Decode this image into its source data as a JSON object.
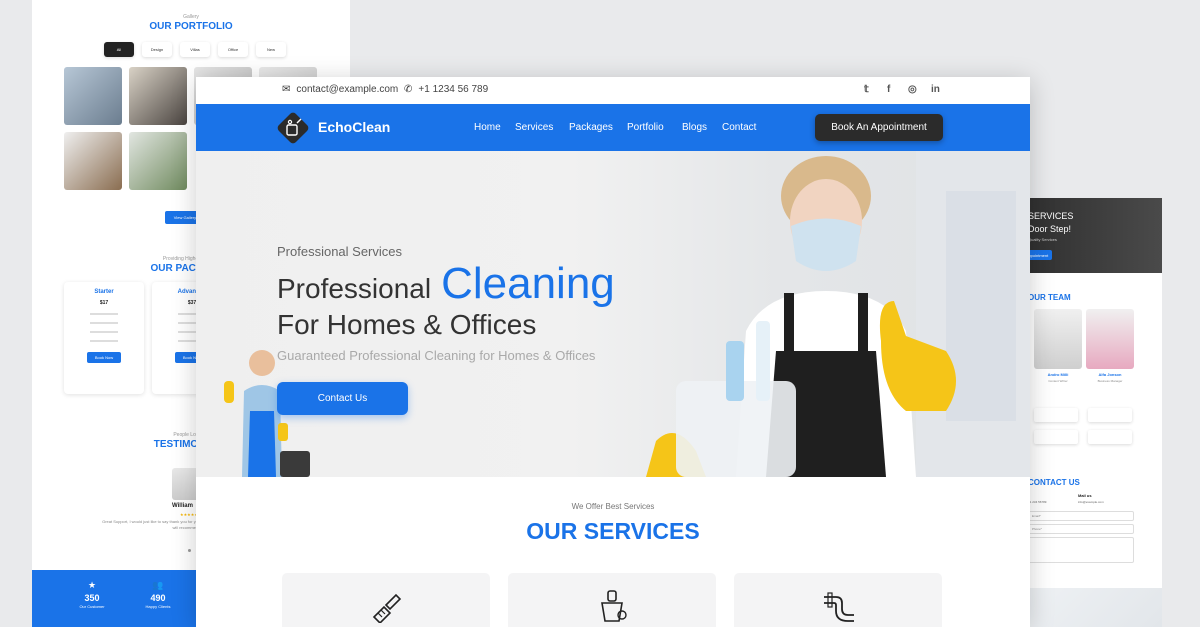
{
  "left_page": {
    "portfolio": {
      "kicker": "Gallery",
      "title": "OUR PORTFOLIO",
      "tabs": [
        "All",
        "Design",
        "Villas",
        "Office",
        "New"
      ],
      "button": "View Gallery"
    },
    "packages": {
      "kicker": "Providing Highest Quality",
      "title": "OUR PACKAGES",
      "cards": [
        {
          "name": "Starter",
          "price": "$17",
          "button": "Book Now"
        },
        {
          "name": "Advanced",
          "price": "$37",
          "button": "Book Now"
        }
      ]
    },
    "testimonials": {
      "kicker": "People Love Us",
      "title": "TESTIMONIALS",
      "person": "William",
      "stars": "★★★★★",
      "quote": "Great Support, I would just like to say thank you for your prompt and professional support staff! I will recommend."
    },
    "stats": [
      {
        "icon": "★",
        "number": "350",
        "label": "Our Customer"
      },
      {
        "icon": "👥",
        "number": "490",
        "label": "Happy Clients"
      }
    ]
  },
  "right_page": {
    "hero": {
      "line1": "SERVICES",
      "line2": "Door Step!",
      "line3": "Quality Services",
      "button": "Appointment"
    },
    "team_title": "OUR TEAM",
    "team": [
      {
        "name": "Andro Milli",
        "role": "Content Writer"
      },
      {
        "name": "Alfa Jonson",
        "role": "Business Manager"
      }
    ],
    "contact_title": "CONTACT US",
    "contact": {
      "mail_label": "Mail us",
      "mail_value": "info@example.com",
      "phone_value": "+1 234 56789"
    },
    "form_placeholders": [
      "Email*",
      "Phone*"
    ]
  },
  "main": {
    "topbar": {
      "email": "contact@example.com",
      "phone": "+1 1234 56 789",
      "social": [
        "twitter",
        "facebook",
        "instagram",
        "linkedin"
      ]
    },
    "nav": {
      "brand": "EchoClean",
      "items": [
        "Home",
        "Services",
        "Packages",
        "Portfolio",
        "Blogs",
        "Contact"
      ],
      "cta": "Book An Appointment"
    },
    "hero": {
      "kicker": "Professional Services",
      "line1_a": "Professional",
      "line1_b": "Cleaning",
      "line2": "For Homes & Offices",
      "subtitle": "Guaranteed Professional Cleaning for Homes & Offices",
      "button": "Contact Us"
    },
    "services": {
      "kicker": "We Offer Best Services",
      "title": "OUR SERVICES"
    }
  },
  "colors": {
    "accent": "#1a73e8",
    "dark": "#2b2b2b",
    "glove": "#f5c518"
  }
}
